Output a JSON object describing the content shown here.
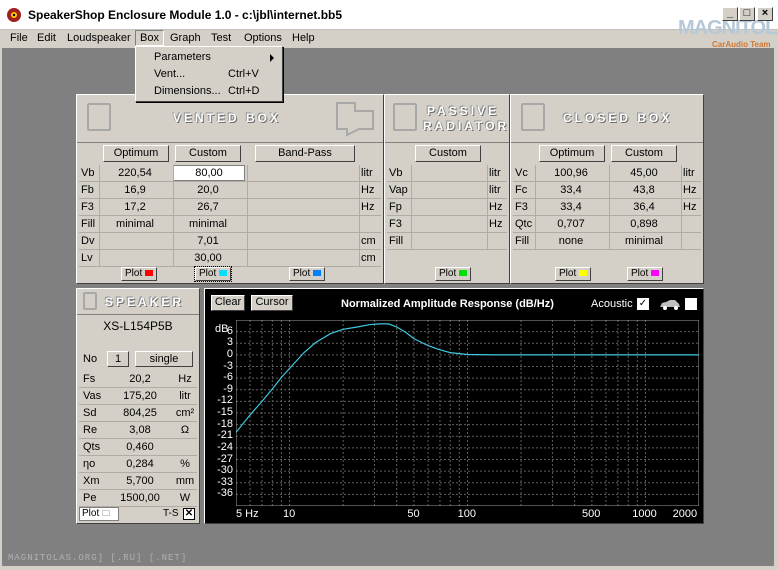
{
  "window": {
    "title": "SpeakerShop Enclosure Module 1.0 - c:\\jbl\\internet.bb5",
    "watermark": "MAGNITOLA",
    "watermark_sub": "CarAudio Team"
  },
  "menu": [
    "File",
    "Edit",
    "Loudspeaker",
    "Box",
    "Graph",
    "Test",
    "Options",
    "Help"
  ],
  "box_menu": [
    {
      "label": "Parameters",
      "shortcut": "",
      "submenu": true
    },
    {
      "label": "Vent...",
      "shortcut": "Ctrl+V",
      "submenu": false
    },
    {
      "label": "Dimensions...",
      "shortcut": "Ctrl+D",
      "submenu": false
    }
  ],
  "vented": {
    "title": "VENTED BOX",
    "buttons": [
      "Optimum",
      "Custom",
      "Band-Pass"
    ],
    "rows": [
      {
        "label": "Vb",
        "opt": "220,54",
        "cust": "80,00",
        "unit": "litr"
      },
      {
        "label": "Fb",
        "opt": "16,9",
        "cust": "20,0",
        "unit": "Hz"
      },
      {
        "label": "F3",
        "opt": "17,2",
        "cust": "26,7",
        "unit": "Hz"
      },
      {
        "label": "Fill",
        "opt": "minimal",
        "cust": "minimal",
        "unit": ""
      },
      {
        "label": "Dv",
        "opt": "",
        "cust": "7,01",
        "unit": "cm"
      },
      {
        "label": "Lv",
        "opt": "",
        "cust": "30,00",
        "unit": "cm"
      }
    ],
    "plot": "Plot"
  },
  "passive": {
    "title1": "PASSIVE",
    "title2": "RADIATOR",
    "button": "Custom",
    "rows": [
      {
        "label": "Vb",
        "unit": "litr"
      },
      {
        "label": "Vap",
        "unit": "litr"
      },
      {
        "label": "Fp",
        "unit": "Hz"
      },
      {
        "label": "F3",
        "unit": "Hz"
      },
      {
        "label": "Fill",
        "unit": ""
      }
    ],
    "plot": "Plot"
  },
  "closed": {
    "title": "CLOSED BOX",
    "buttons": [
      "Optimum",
      "Custom"
    ],
    "rows": [
      {
        "label": "Vc",
        "opt": "100,96",
        "cust": "45,00",
        "unit": "litr"
      },
      {
        "label": "Fc",
        "opt": "33,4",
        "cust": "43,8",
        "unit": "Hz"
      },
      {
        "label": "F3",
        "opt": "33,4",
        "cust": "36,4",
        "unit": "Hz"
      },
      {
        "label": "Qtc",
        "opt": "0,707",
        "cust": "0,898",
        "unit": ""
      },
      {
        "label": "Fill",
        "opt": "none",
        "cust": "minimal",
        "unit": ""
      }
    ],
    "plot": "Plot"
  },
  "speaker": {
    "title": "SPEAKER",
    "model": "XS-L154P5B",
    "no_label": "No",
    "no_value": "1",
    "mode": "single",
    "rows": [
      {
        "label": "Fs",
        "value": "20,2",
        "unit": "Hz"
      },
      {
        "label": "Vas",
        "value": "175,20",
        "unit": "litr"
      },
      {
        "label": "Sd",
        "value": "804,25",
        "unit": "cm²"
      },
      {
        "label": "Re",
        "value": "3,08",
        "unit": "Ω"
      },
      {
        "label": "Qts",
        "value": "0,460",
        "unit": ""
      },
      {
        "label": "ηo",
        "value": "0,284",
        "unit": "%"
      },
      {
        "label": "Xm",
        "value": "5,700",
        "unit": "mm"
      },
      {
        "label": "Pe",
        "value": "1500,00",
        "unit": "W"
      }
    ],
    "plot": "Plot",
    "ts": "T-S"
  },
  "graph": {
    "clear": "Clear",
    "cursor": "Cursor",
    "acoustic": "Acoustic",
    "db_label": "dB"
  },
  "colors": {
    "vented_opt": "#ff0000",
    "vented_cust": "#00e0ff",
    "bandpass": "#0080ff",
    "passive": "#00e000",
    "closed_opt": "#ffff00",
    "closed_cust": "#ff00ff",
    "curve": "#40c8e0"
  },
  "chart_data": {
    "type": "line",
    "title": "Normalized Amplitude Response (dB/Hz)",
    "xscale": "log",
    "xlim": [
      5,
      2000
    ],
    "ylim": [
      -39,
      9
    ],
    "yticks": [
      6,
      3,
      0,
      -3,
      -6,
      -9,
      -12,
      -15,
      -18,
      -21,
      -24,
      -27,
      -30,
      -33,
      -36
    ],
    "xtick_labels": [
      "5 Hz",
      "10",
      "50",
      "100",
      "500",
      "1000",
      "2000"
    ],
    "xtick_values": [
      5,
      10,
      50,
      100,
      500,
      1000,
      2000
    ],
    "grid": true,
    "series": [
      {
        "x": [
          5,
          6,
          7,
          8,
          9,
          10,
          12,
          14,
          17,
          20,
          24,
          28,
          32,
          36,
          40,
          45,
          50,
          60,
          70,
          80,
          100,
          150,
          200,
          300,
          500,
          1000,
          2000
        ],
        "y": [
          -20,
          -15.5,
          -12,
          -8.8,
          -5.8,
          -3.5,
          0.5,
          3.2,
          5.5,
          6.6,
          7.2,
          7.8,
          8,
          8,
          7.2,
          5.8,
          4.2,
          2.4,
          1.3,
          0.6,
          0.1,
          0,
          0,
          0,
          0,
          0,
          0
        ]
      }
    ]
  }
}
